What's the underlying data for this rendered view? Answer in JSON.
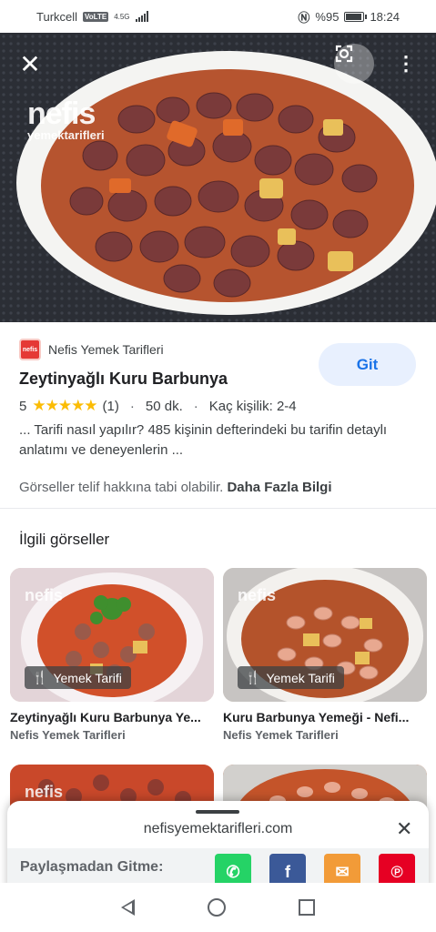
{
  "status_bar": {
    "carrier": "Turkcell",
    "volte": "VoLTE",
    "network": "4.5G",
    "battery": "%95",
    "battery_level": 0.95,
    "time": "18:24"
  },
  "hero": {
    "watermark_line1": "nefis",
    "watermark_line2": "yemektarifleri"
  },
  "result": {
    "source_name": "Nefis Yemek Tarifleri",
    "source_logo_text": "nefis",
    "go_label": "Git",
    "title": "Zeytinyağlı Kuru Barbunya",
    "rating": "5",
    "stars": "★★★★★",
    "rating_count": "(1)",
    "duration": "50 dk.",
    "servings": "Kaç kişilik: 2-4",
    "description": "... Tarifi nasıl yapılır? 485 kişinin defterindeki bu tarifin detaylı anlatımı ve deneyenlerin ...",
    "copyright_text": "Görseller telif hakkına tabi olabilir.",
    "learn_more": "Daha Fazla Bilgi"
  },
  "related": {
    "heading": "İlgili görseller",
    "cards": [
      {
        "chip": "Yemek Tarifi",
        "title": "Zeytinyağlı Kuru Barbunya Ye...",
        "source": "Nefis Yemek Tarifleri",
        "watermark": "nefis"
      },
      {
        "chip": "Yemek Tarifi",
        "title": "Kuru Barbunya Yemeği - Nefi...",
        "source": "Nefis Yemek Tarifleri",
        "watermark": "nefis"
      }
    ],
    "partial_watermark": "nefis"
  },
  "sheet": {
    "url": "nefisyemektarifleri.com",
    "share_label": "Paylaşmadan Gitme:",
    "share_buttons": [
      {
        "icon": "whatsapp-icon",
        "color": "#25d366"
      },
      {
        "icon": "facebook-icon",
        "glyph": "f",
        "color": "#3b5998"
      },
      {
        "icon": "mail-icon",
        "color": "#f29b38"
      },
      {
        "icon": "pinterest-icon",
        "glyph": "℗",
        "color": "#e60023"
      }
    ]
  },
  "colors": {
    "accent": "#1a73e8",
    "star": "#fbbc04"
  }
}
